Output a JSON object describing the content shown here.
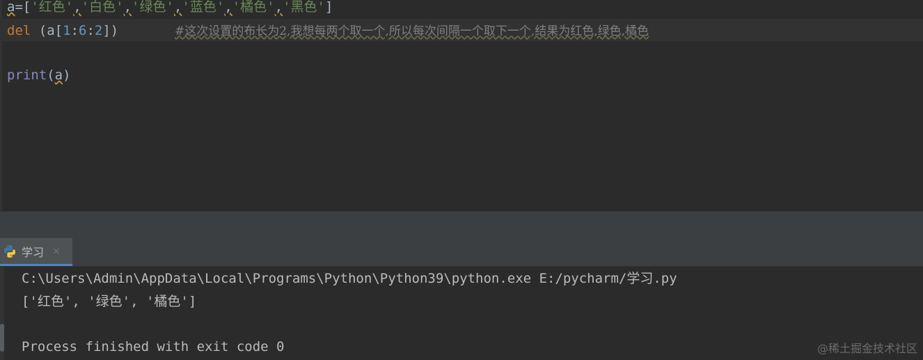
{
  "editor": {
    "line1": {
      "var": "a",
      "eq": "=[",
      "items": [
        "'红色'",
        "'白色'",
        "'绿色'",
        "'蓝色'",
        "'橘色'",
        "'黑色'"
      ],
      "sep": ",",
      "close": "]"
    },
    "line2": {
      "keyword": "del",
      "open": " (a[",
      "n1": "1",
      "c1": ":",
      "n2": "6",
      "c2": ":",
      "n3": "2",
      "close": "])",
      "comment": "#这次设置的布长为2,我想每两个取一个,所以每次间隔一个取下一个,结果为红色,绿色,橘色"
    },
    "line4": {
      "fn": "print",
      "open": "(",
      "arg": "a",
      "close": ")"
    }
  },
  "run_panel": {
    "tab_label": "学习",
    "close_glyph": "×",
    "icon": "python-icon"
  },
  "console": {
    "cmd": "C:\\Users\\Admin\\AppData\\Local\\Programs\\Python\\Python39\\python.exe E:/pycharm/学习.py",
    "output": "['红色', '绿色', '橘色']",
    "exit": "Process finished with exit code 0"
  },
  "watermark": "@稀土掘金技术社区",
  "colors": {
    "background": "#2b2b2b",
    "string": "#6a8759",
    "keyword": "#cc7832",
    "number": "#6897bb",
    "comment": "#808080",
    "accent": "#4a88c7"
  }
}
